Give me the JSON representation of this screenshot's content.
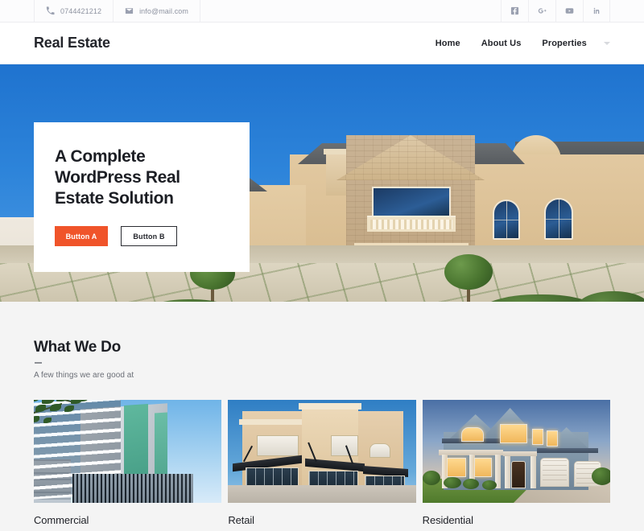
{
  "topbar": {
    "phone": {
      "icon": "phone-icon",
      "text": "0744421212"
    },
    "email": {
      "icon": "envelope-icon",
      "text": "info@mail.com"
    },
    "social": [
      {
        "name": "facebook-icon",
        "label": "Facebook"
      },
      {
        "name": "google-plus-icon",
        "label": "Google Plus"
      },
      {
        "name": "youtube-icon",
        "label": "YouTube"
      },
      {
        "name": "linkedin-icon",
        "label": "LinkedIn"
      }
    ]
  },
  "header": {
    "logo": "Real Estate",
    "nav": [
      {
        "label": "Home",
        "has_dropdown": false
      },
      {
        "label": "About Us",
        "has_dropdown": false
      },
      {
        "label": "Properties",
        "has_dropdown": true
      }
    ]
  },
  "hero": {
    "title": "A Complete WordPress Real Estate Solution",
    "button_a": "Button A",
    "button_b": "Button B",
    "image_alt": "Luxury tan stucco and stone mansion with arched entry and balcony under a vivid blue sky",
    "accent_color": "#f0542a",
    "sky_color": "#2b7fd4"
  },
  "what_we_do": {
    "title": "What We Do",
    "subtitle": "A few things we are good at",
    "cards": [
      {
        "label": "Commercial",
        "image_alt": "Modern multi-story commercial office building with green glass accents"
      },
      {
        "label": "Retail",
        "image_alt": "Tan retail strip mall with black awnings and glass storefronts"
      },
      {
        "label": "Residential",
        "image_alt": "Blue-gray two-story suburban home at dusk with lit windows and green lawn"
      }
    ]
  },
  "theme": {
    "background": "#ffffff",
    "section_background": "#f4f4f4",
    "text_dark": "#1d1f25",
    "text_muted": "#6b6f77"
  }
}
